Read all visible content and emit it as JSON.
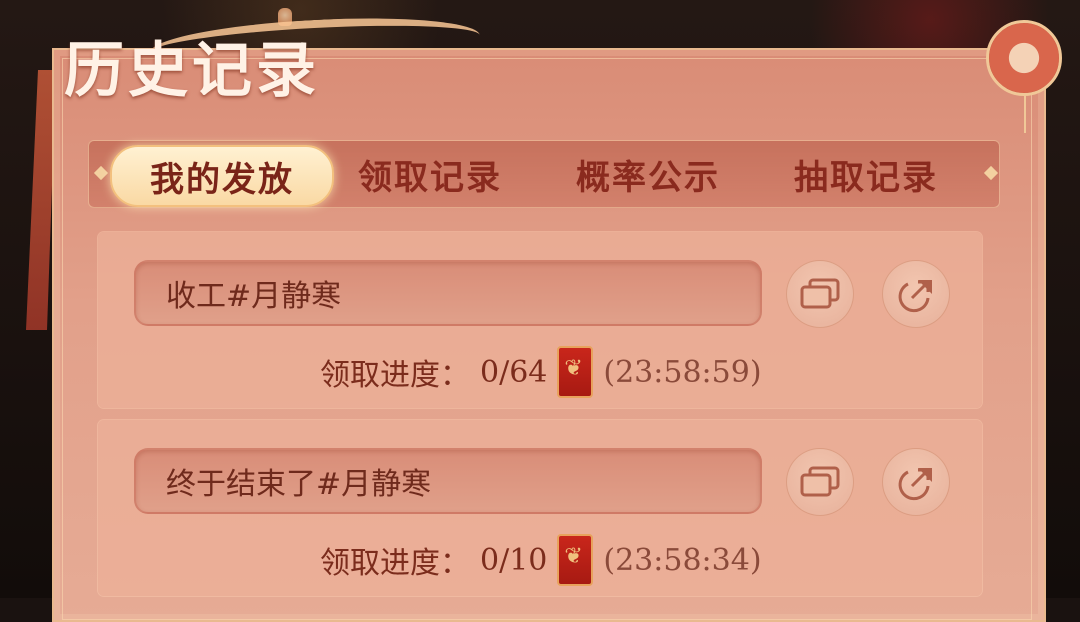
{
  "title": "历史记录",
  "tabs": [
    {
      "label": "我的发放",
      "active": true
    },
    {
      "label": "领取记录",
      "active": false
    },
    {
      "label": "概率公示",
      "active": false
    },
    {
      "label": "抽取记录",
      "active": false
    }
  ],
  "records": [
    {
      "message": "收工#月静寒",
      "progress_label": "领取进度：",
      "progress_value": "0/64",
      "time": "(23:58:59)"
    },
    {
      "message": "终于结束了#月静寒",
      "progress_label": "领取进度：",
      "progress_value": "0/10",
      "time": "(23:58:34)"
    }
  ],
  "colors": {
    "accent": "#8a2a1e",
    "panel": "#e2a08a",
    "active_tab": "#fad9a4"
  },
  "icons": {
    "copy": "copy-icon",
    "share": "share-icon",
    "red_envelope": "red-envelope-icon",
    "medallion": "medallion-icon"
  }
}
